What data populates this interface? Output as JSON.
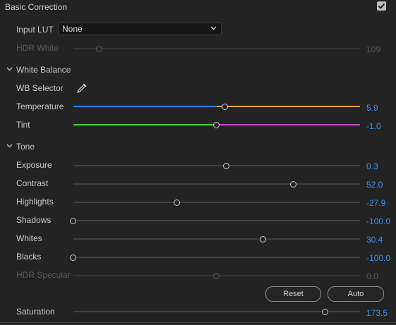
{
  "header": {
    "title": "Basic Correction",
    "enabled": true
  },
  "input_lut": {
    "label": "Input LUT",
    "value": "None"
  },
  "hdr_white": {
    "label": "HDR White",
    "value": "109",
    "level": 0.09
  },
  "white_balance": {
    "section_label": "White Balance",
    "wb_selector_label": "WB Selector",
    "temperature": {
      "label": "Temperature",
      "value": "5.9",
      "level": 0.53
    },
    "tint": {
      "label": "Tint",
      "value": "-1.0",
      "level": 0.499
    }
  },
  "tone": {
    "section_label": "Tone",
    "sliders": [
      {
        "label": "Exposure",
        "value": "0.3",
        "level": 0.535
      },
      {
        "label": "Contrast",
        "value": "52.0",
        "level": 0.768
      },
      {
        "label": "Highlights",
        "value": "-27.9",
        "level": 0.362
      },
      {
        "label": "Shadows",
        "value": "-100.0",
        "level": 0.0
      },
      {
        "label": "Whites",
        "value": "30.4",
        "level": 0.662
      },
      {
        "label": "Blacks",
        "value": "-100.0",
        "level": 0.0
      }
    ],
    "hdr_specular": {
      "label": "HDR Specular",
      "value": "0.0",
      "level": 0.5
    }
  },
  "buttons": {
    "reset": "Reset",
    "auto": "Auto"
  },
  "saturation": {
    "label": "Saturation",
    "value": "173.5",
    "level": 0.88
  },
  "colors": {
    "accent": "#3c8ee0",
    "temp_cool": "#2f7ee8",
    "temp_warm": "#e8a33a",
    "tint_green": "#3fd43f",
    "tint_magenta": "#cc44cc"
  }
}
